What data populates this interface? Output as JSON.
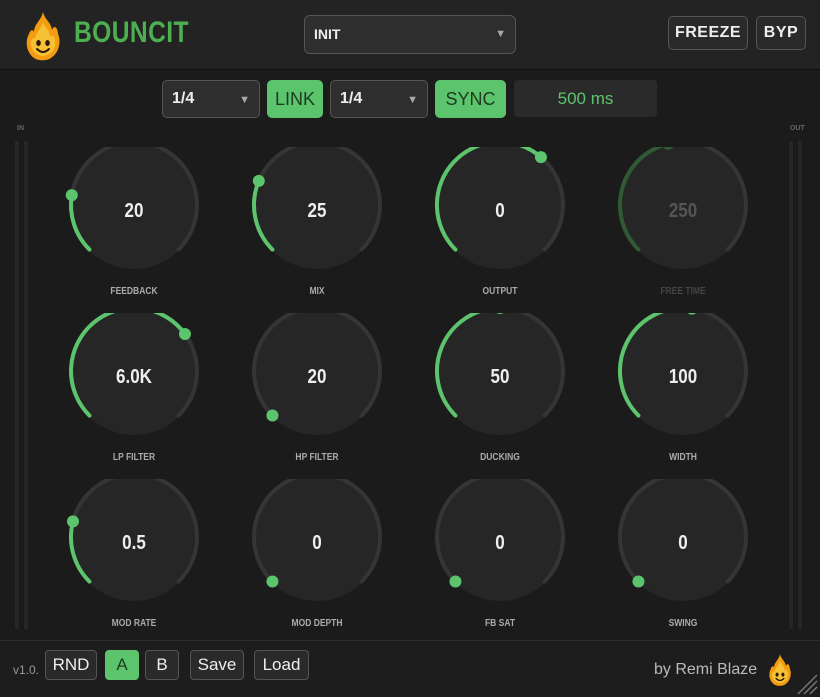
{
  "header": {
    "brand": "BOUNCIT",
    "preset": "INIT",
    "freeze_label": "FREEZE",
    "bypass_label": "BYP"
  },
  "timing": {
    "left_division": "1/4",
    "link_label": "LINK",
    "right_division": "1/4",
    "sync_label": "SYNC",
    "time_display": "500 ms"
  },
  "meters": {
    "in_label": "IN",
    "out_label": "OUT"
  },
  "knobs": [
    {
      "label": "FEEDBACK",
      "value": "20",
      "level": 0.2,
      "enabled": true
    },
    {
      "label": "MIX",
      "value": "25",
      "level": 0.25,
      "enabled": true
    },
    {
      "label": "OUTPUT",
      "value": "0",
      "level": 0.65,
      "enabled": true
    },
    {
      "label": "FREE TIME",
      "value": "250",
      "level": 0.45,
      "enabled": false
    },
    {
      "label": "LP FILTER",
      "value": "6.0K",
      "level": 0.7,
      "enabled": true
    },
    {
      "label": "HP FILTER",
      "value": "20",
      "level": 0.0,
      "enabled": true
    },
    {
      "label": "DUCKING",
      "value": "50",
      "level": 0.5,
      "enabled": true
    },
    {
      "label": "WIDTH",
      "value": "100",
      "level": 0.53,
      "enabled": true
    },
    {
      "label": "MOD RATE",
      "value": "0.5",
      "level": 0.22,
      "enabled": true
    },
    {
      "label": "MOD DEPTH",
      "value": "0",
      "level": 0.0,
      "enabled": true
    },
    {
      "label": "FB SAT",
      "value": "0",
      "level": 0.0,
      "enabled": true
    },
    {
      "label": "SWING",
      "value": "0",
      "level": 0.0,
      "enabled": true
    }
  ],
  "footer": {
    "version": "v1.0.",
    "rnd_label": "RND",
    "a_label": "A",
    "b_label": "B",
    "save_label": "Save",
    "load_label": "Load",
    "credit": "by Remi Blaze"
  },
  "colors": {
    "accent": "#5cc46c",
    "accent_dim": "#2f5a34",
    "background": "#1b1b1b",
    "knob_body": "#262626",
    "track": "#353535"
  },
  "icons": {
    "logo": "flame-mascot-icon",
    "dropdown": "caret-down-icon",
    "resize": "resize-grip-icon"
  }
}
